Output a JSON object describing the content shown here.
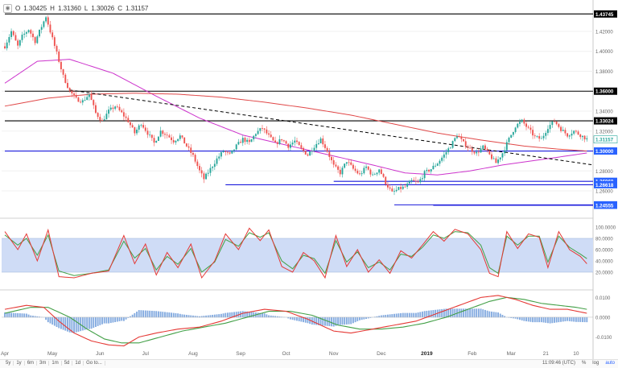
{
  "header": {
    "open_label": "O",
    "open": "1.30425",
    "high_label": "H",
    "high": "1.31360",
    "low_label": "L",
    "low": "1.30026",
    "close_label": "C",
    "close": "1.31157"
  },
  "bottom_bar": {
    "timeframes": [
      "5y",
      "1y",
      "6m",
      "3m",
      "1m",
      "5d",
      "1d"
    ],
    "goto": "Go to...",
    "clock": "11:09:46 (UTC)",
    "percent": "%",
    "log": "log",
    "auto": "auto"
  },
  "colors": {
    "bull": "#26a69a",
    "bear": "#ef5350",
    "level": "#000000",
    "support": "#1a1adc",
    "ma_magenta": "#cc33cc",
    "ma_red": "#e04848",
    "stoch_k": "#e53935",
    "stoch_d": "#43a047",
    "stoch_band": "#cfdcf6",
    "hist": "#5b8fd6",
    "label_blue": "#2962ff",
    "label_black": "#000000"
  },
  "chart_data": {
    "type": "candlestick",
    "symbol_hidden": true,
    "x_axis": {
      "ticks": [
        "Apr",
        "May",
        "Jun",
        "Jul",
        "Aug",
        "Sep",
        "Oct",
        "Nov",
        "Dec",
        "2019",
        "Feb",
        "Mar",
        "21",
        "10"
      ],
      "tick_positions_bar_index": [
        0,
        22,
        44,
        65,
        87,
        109,
        130,
        152,
        174,
        195,
        216,
        234,
        250,
        264
      ]
    },
    "price_axis": {
      "range": [
        1.235,
        1.445
      ],
      "ticks": [
        "1.42000",
        "1.40000",
        "1.38000",
        "1.36000",
        "1.34000",
        "1.32000",
        "1.30000",
        "1.28000",
        "1.26000"
      ]
    },
    "price_labels": [
      {
        "value": "1.43745",
        "price": 1.43745,
        "color": "black"
      },
      {
        "value": "1.36000",
        "price": 1.36,
        "color": "black"
      },
      {
        "value": "1.33024",
        "price": 1.33024,
        "color": "black"
      },
      {
        "value": "1.31157",
        "price": 1.31157,
        "color": "current"
      },
      {
        "value": "1.30000",
        "price": 1.3,
        "color": "blue"
      },
      {
        "value": "1.26960",
        "price": 1.2696,
        "color": "blue"
      },
      {
        "value": "1.26618",
        "price": 1.26618,
        "color": "blue"
      },
      {
        "value": "1.24601",
        "price": 1.24601,
        "color": "blue"
      },
      {
        "value": "1.24555",
        "price": 1.24555,
        "color": "blue"
      }
    ],
    "horizontal_levels": [
      {
        "price": 1.43745,
        "color": "black",
        "from_bar": 0
      },
      {
        "price": 1.36,
        "color": "black",
        "from_bar": 0
      },
      {
        "price": 1.33024,
        "color": "black",
        "from_bar": 0
      },
      {
        "price": 1.3,
        "color": "blue",
        "from_bar": 0
      },
      {
        "price": 1.2696,
        "color": "blue",
        "from_bar": 152
      },
      {
        "price": 1.26618,
        "color": "blue",
        "from_bar": 102
      },
      {
        "price": 1.24601,
        "color": "blue",
        "from_bar": 180
      },
      {
        "price": 1.24555,
        "color": "blue",
        "from_bar": 198
      }
    ],
    "trendline": {
      "from": [
        30,
        1.3612
      ],
      "to": [
        272,
        1.286
      ],
      "style": "dashed"
    },
    "closes_anchor": [
      [
        0,
        1.405
      ],
      [
        3,
        1.42
      ],
      [
        6,
        1.405
      ],
      [
        8,
        1.415
      ],
      [
        11,
        1.422
      ],
      [
        14,
        1.41
      ],
      [
        17,
        1.425
      ],
      [
        19,
        1.435
      ],
      [
        21,
        1.42
      ],
      [
        24,
        1.398
      ],
      [
        27,
        1.375
      ],
      [
        30,
        1.36
      ],
      [
        33,
        1.352
      ],
      [
        36,
        1.35
      ],
      [
        39,
        1.357
      ],
      [
        42,
        1.338
      ],
      [
        45,
        1.33
      ],
      [
        48,
        1.34
      ],
      [
        51,
        1.345
      ],
      [
        54,
        1.338
      ],
      [
        57,
        1.33
      ],
      [
        60,
        1.318
      ],
      [
        63,
        1.328
      ],
      [
        66,
        1.318
      ],
      [
        69,
        1.308
      ],
      [
        72,
        1.32
      ],
      [
        75,
        1.316
      ],
      [
        78,
        1.31
      ],
      [
        81,
        1.315
      ],
      [
        84,
        1.305
      ],
      [
        87,
        1.295
      ],
      [
        90,
        1.28
      ],
      [
        92,
        1.272
      ],
      [
        95,
        1.282
      ],
      [
        98,
        1.292
      ],
      [
        101,
        1.3
      ],
      [
        104,
        1.296
      ],
      [
        107,
        1.305
      ],
      [
        110,
        1.312
      ],
      [
        113,
        1.308
      ],
      [
        116,
        1.318
      ],
      [
        119,
        1.323
      ],
      [
        122,
        1.315
      ],
      [
        125,
        1.307
      ],
      [
        128,
        1.312
      ],
      [
        131,
        1.305
      ],
      [
        134,
        1.31
      ],
      [
        137,
        1.302
      ],
      [
        140,
        1.296
      ],
      [
        143,
        1.305
      ],
      [
        146,
        1.312
      ],
      [
        149,
        1.3
      ],
      [
        152,
        1.285
      ],
      [
        155,
        1.278
      ],
      [
        158,
        1.29
      ],
      [
        161,
        1.282
      ],
      [
        164,
        1.276
      ],
      [
        167,
        1.284
      ],
      [
        170,
        1.275
      ],
      [
        173,
        1.282
      ],
      [
        176,
        1.268
      ],
      [
        179,
        1.258
      ],
      [
        182,
        1.262
      ],
      [
        185,
        1.264
      ],
      [
        188,
        1.27
      ],
      [
        191,
        1.268
      ],
      [
        194,
        1.278
      ],
      [
        197,
        1.282
      ],
      [
        200,
        1.288
      ],
      [
        203,
        1.296
      ],
      [
        206,
        1.305
      ],
      [
        209,
        1.316
      ],
      [
        212,
        1.308
      ],
      [
        215,
        1.302
      ],
      [
        218,
        1.298
      ],
      [
        221,
        1.304
      ],
      [
        224,
        1.296
      ],
      [
        227,
        1.288
      ],
      [
        230,
        1.298
      ],
      [
        233,
        1.312
      ],
      [
        236,
        1.325
      ],
      [
        239,
        1.33
      ],
      [
        242,
        1.322
      ],
      [
        245,
        1.314
      ],
      [
        248,
        1.312
      ],
      [
        251,
        1.324
      ],
      [
        254,
        1.33
      ],
      [
        257,
        1.322
      ],
      [
        260,
        1.316
      ],
      [
        263,
        1.32
      ],
      [
        266,
        1.316
      ],
      [
        269,
        1.312
      ]
    ],
    "moving_average_magenta_anchor": [
      [
        0,
        1.368
      ],
      [
        15,
        1.39
      ],
      [
        30,
        1.392
      ],
      [
        50,
        1.378
      ],
      [
        70,
        1.355
      ],
      [
        90,
        1.333
      ],
      [
        110,
        1.316
      ],
      [
        130,
        1.306
      ],
      [
        150,
        1.296
      ],
      [
        170,
        1.286
      ],
      [
        185,
        1.278
      ],
      [
        200,
        1.276
      ],
      [
        215,
        1.28
      ],
      [
        230,
        1.286
      ],
      [
        250,
        1.292
      ],
      [
        269,
        1.298
      ]
    ],
    "moving_average_red_anchor": [
      [
        0,
        1.345
      ],
      [
        20,
        1.353
      ],
      [
        40,
        1.357
      ],
      [
        60,
        1.358
      ],
      [
        80,
        1.357
      ],
      [
        100,
        1.354
      ],
      [
        120,
        1.349
      ],
      [
        140,
        1.343
      ],
      [
        160,
        1.336
      ],
      [
        180,
        1.327
      ],
      [
        200,
        1.318
      ],
      [
        220,
        1.311
      ],
      [
        240,
        1.305
      ],
      [
        255,
        1.302
      ],
      [
        269,
        1.3
      ]
    ],
    "stochastic": {
      "ticks": [
        "100.0000",
        "80.0000",
        "60.0000",
        "40.0000",
        "20.0000"
      ],
      "band": [
        20,
        80
      ],
      "k_anchor": [
        [
          0,
          92
        ],
        [
          6,
          60
        ],
        [
          10,
          88
        ],
        [
          15,
          40
        ],
        [
          20,
          95
        ],
        [
          25,
          12
        ],
        [
          32,
          10
        ],
        [
          40,
          18
        ],
        [
          48,
          22
        ],
        [
          55,
          85
        ],
        [
          60,
          35
        ],
        [
          65,
          70
        ],
        [
          70,
          15
        ],
        [
          75,
          55
        ],
        [
          80,
          28
        ],
        [
          86,
          70
        ],
        [
          91,
          10
        ],
        [
          97,
          40
        ],
        [
          102,
          88
        ],
        [
          108,
          60
        ],
        [
          113,
          98
        ],
        [
          118,
          76
        ],
        [
          122,
          95
        ],
        [
          128,
          30
        ],
        [
          133,
          20
        ],
        [
          138,
          55
        ],
        [
          143,
          40
        ],
        [
          148,
          10
        ],
        [
          153,
          85
        ],
        [
          158,
          30
        ],
        [
          163,
          60
        ],
        [
          168,
          20
        ],
        [
          173,
          42
        ],
        [
          178,
          18
        ],
        [
          183,
          58
        ],
        [
          188,
          45
        ],
        [
          193,
          68
        ],
        [
          198,
          92
        ],
        [
          203,
          75
        ],
        [
          208,
          96
        ],
        [
          214,
          88
        ],
        [
          220,
          60
        ],
        [
          224,
          18
        ],
        [
          228,
          12
        ],
        [
          232,
          92
        ],
        [
          237,
          62
        ],
        [
          242,
          88
        ],
        [
          247,
          82
        ],
        [
          251,
          28
        ],
        [
          256,
          92
        ],
        [
          261,
          60
        ],
        [
          266,
          48
        ],
        [
          269,
          35
        ]
      ],
      "d_anchor": [
        [
          0,
          86
        ],
        [
          6,
          68
        ],
        [
          10,
          80
        ],
        [
          15,
          50
        ],
        [
          20,
          86
        ],
        [
          25,
          22
        ],
        [
          32,
          14
        ],
        [
          40,
          18
        ],
        [
          48,
          24
        ],
        [
          55,
          75
        ],
        [
          60,
          45
        ],
        [
          65,
          62
        ],
        [
          70,
          24
        ],
        [
          75,
          48
        ],
        [
          80,
          34
        ],
        [
          86,
          62
        ],
        [
          91,
          20
        ],
        [
          97,
          38
        ],
        [
          102,
          78
        ],
        [
          108,
          66
        ],
        [
          113,
          90
        ],
        [
          118,
          82
        ],
        [
          122,
          90
        ],
        [
          128,
          40
        ],
        [
          133,
          26
        ],
        [
          138,
          50
        ],
        [
          143,
          44
        ],
        [
          148,
          18
        ],
        [
          153,
          76
        ],
        [
          158,
          38
        ],
        [
          163,
          56
        ],
        [
          168,
          28
        ],
        [
          173,
          38
        ],
        [
          178,
          24
        ],
        [
          183,
          52
        ],
        [
          188,
          48
        ],
        [
          193,
          64
        ],
        [
          198,
          86
        ],
        [
          203,
          80
        ],
        [
          208,
          92
        ],
        [
          214,
          90
        ],
        [
          220,
          68
        ],
        [
          224,
          28
        ],
        [
          228,
          18
        ],
        [
          232,
          84
        ],
        [
          237,
          68
        ],
        [
          242,
          84
        ],
        [
          247,
          84
        ],
        [
          251,
          38
        ],
        [
          256,
          84
        ],
        [
          261,
          64
        ],
        [
          266,
          52
        ],
        [
          269,
          44
        ]
      ]
    },
    "macd": {
      "ticks": [
        "0.0100",
        "0.0000",
        "-0.0100"
      ],
      "range": [
        -0.0155,
        0.013
      ],
      "macd_anchor": [
        [
          0,
          0.004
        ],
        [
          10,
          0.006
        ],
        [
          18,
          0.005
        ],
        [
          25,
          -0.002
        ],
        [
          32,
          -0.008
        ],
        [
          40,
          -0.012
        ],
        [
          48,
          -0.014
        ],
        [
          55,
          -0.0145
        ],
        [
          62,
          -0.01
        ],
        [
          70,
          -0.008
        ],
        [
          80,
          -0.006
        ],
        [
          90,
          -0.005
        ],
        [
          100,
          -0.002
        ],
        [
          110,
          0.002
        ],
        [
          120,
          0.004
        ],
        [
          130,
          0.003
        ],
        [
          140,
          -0.001
        ],
        [
          152,
          -0.007
        ],
        [
          160,
          -0.008
        ],
        [
          170,
          -0.006
        ],
        [
          180,
          -0.004
        ],
        [
          190,
          -0.002
        ],
        [
          200,
          0.002
        ],
        [
          210,
          0.006
        ],
        [
          220,
          0.01
        ],
        [
          228,
          0.011
        ],
        [
          236,
          0.009
        ],
        [
          244,
          0.006
        ],
        [
          252,
          0.004
        ],
        [
          260,
          0.004
        ],
        [
          269,
          0.002
        ]
      ],
      "signal_anchor": [
        [
          0,
          0.002
        ],
        [
          12,
          0.005
        ],
        [
          20,
          0.005
        ],
        [
          30,
          0.0
        ],
        [
          38,
          -0.006
        ],
        [
          46,
          -0.011
        ],
        [
          54,
          -0.013
        ],
        [
          62,
          -0.013
        ],
        [
          72,
          -0.01
        ],
        [
          82,
          -0.007
        ],
        [
          92,
          -0.005
        ],
        [
          102,
          -0.003
        ],
        [
          112,
          0.0
        ],
        [
          122,
          0.003
        ],
        [
          132,
          0.003
        ],
        [
          142,
          0.001
        ],
        [
          154,
          -0.004
        ],
        [
          164,
          -0.006
        ],
        [
          174,
          -0.006
        ],
        [
          184,
          -0.005
        ],
        [
          194,
          -0.003
        ],
        [
          204,
          0.0
        ],
        [
          214,
          0.004
        ],
        [
          224,
          0.008
        ],
        [
          232,
          0.01
        ],
        [
          240,
          0.009
        ],
        [
          248,
          0.007
        ],
        [
          256,
          0.006
        ],
        [
          264,
          0.005
        ],
        [
          269,
          0.004
        ]
      ]
    }
  }
}
